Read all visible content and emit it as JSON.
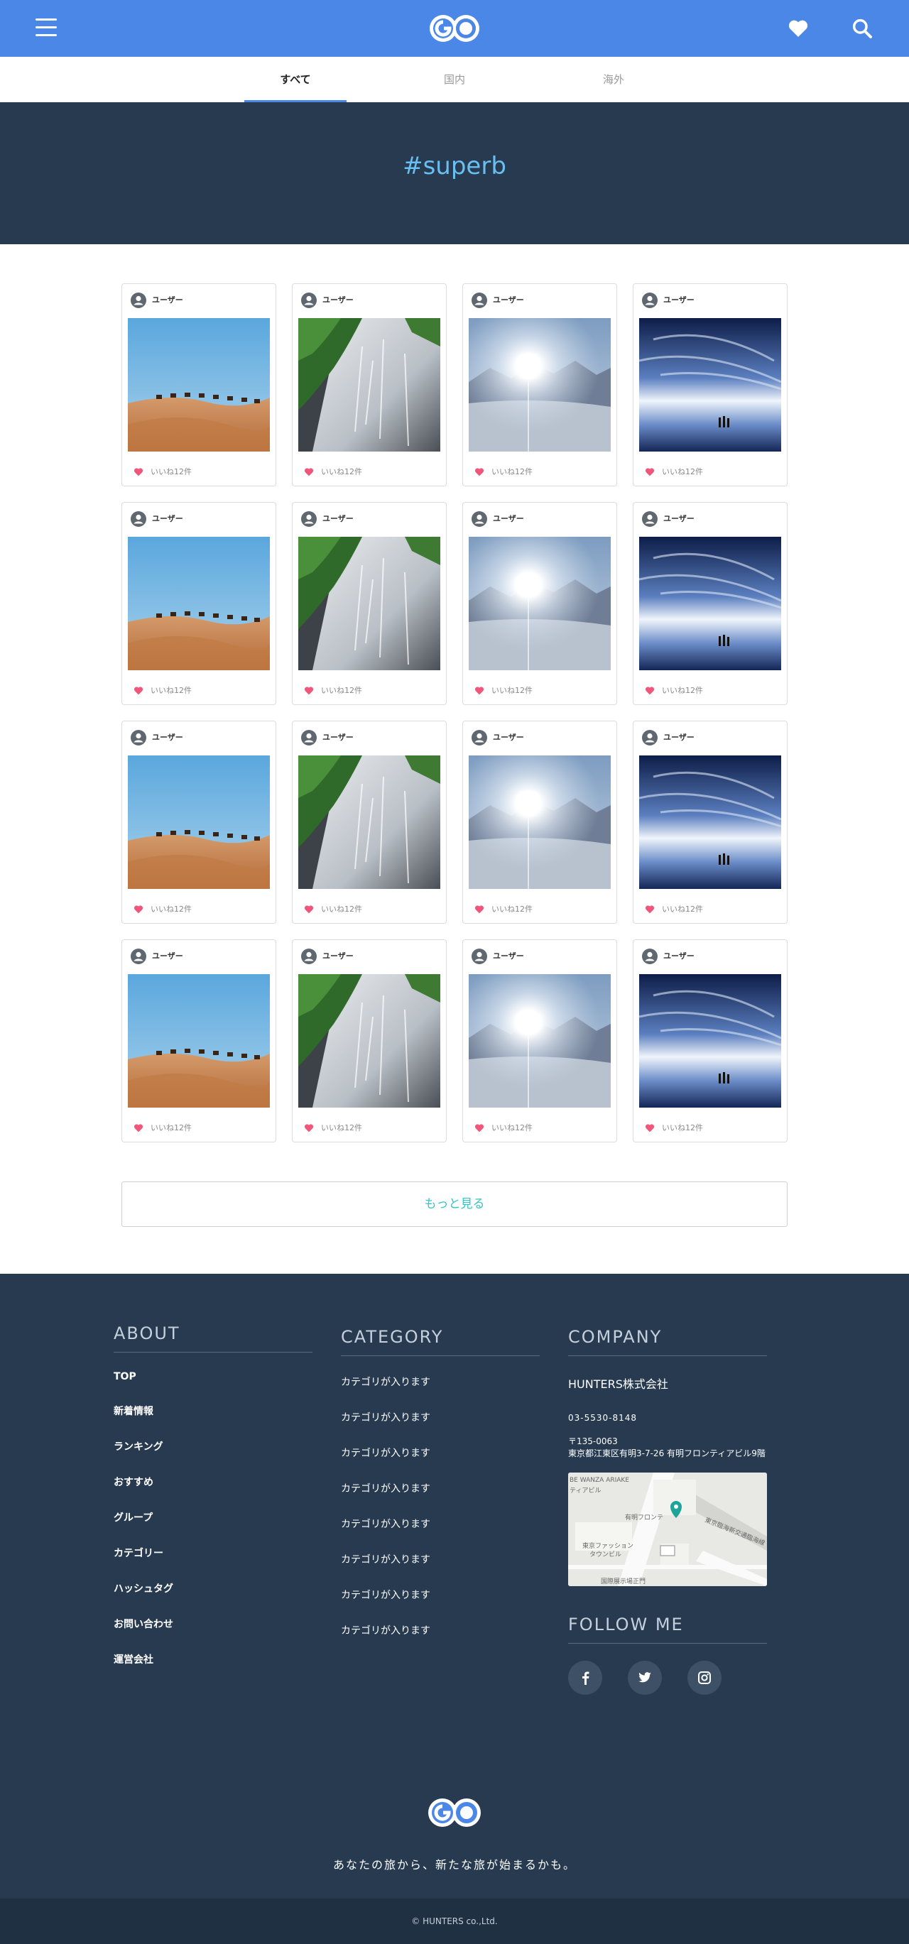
{
  "header": {
    "logo_text": "GO",
    "menu_icon": "hamburger-icon",
    "favorite_icon": "heart-icon",
    "search_icon": "search-icon",
    "brand_color": "#4a87e7"
  },
  "tabs": [
    {
      "label": "すべて",
      "active": true
    },
    {
      "label": "国内",
      "active": false
    },
    {
      "label": "海外",
      "active": false
    }
  ],
  "hero": {
    "title": "#superb"
  },
  "grid": {
    "rows": [
      [
        {
          "user": "ユーザー",
          "likes": "いいね12件",
          "photo": "desert"
        },
        {
          "user": "ユーザー",
          "likes": "いいね12件",
          "photo": "waterfall"
        },
        {
          "user": "ユーザー",
          "likes": "いいね12件",
          "photo": "sunburst"
        },
        {
          "user": "ユーザー",
          "likes": "いいね12件",
          "photo": "salt-flat"
        }
      ],
      [
        {
          "user": "ユーザー",
          "likes": "いいね12件",
          "photo": "desert"
        },
        {
          "user": "ユーザー",
          "likes": "いいね12件",
          "photo": "waterfall"
        },
        {
          "user": "ユーザー",
          "likes": "いいね12件",
          "photo": "sunburst"
        },
        {
          "user": "ユーザー",
          "likes": "いいね12件",
          "photo": "salt-flat"
        }
      ],
      [
        {
          "user": "ユーザー",
          "likes": "いいね12件",
          "photo": "desert"
        },
        {
          "user": "ユーザー",
          "likes": "いいね12件",
          "photo": "waterfall"
        },
        {
          "user": "ユーザー",
          "likes": "いいね12件",
          "photo": "sunburst"
        },
        {
          "user": "ユーザー",
          "likes": "いいね12件",
          "photo": "salt-flat"
        }
      ],
      [
        {
          "user": "ユーザー",
          "likes": "いいね12件",
          "photo": "desert"
        },
        {
          "user": "ユーザー",
          "likes": "いいね12件",
          "photo": "waterfall"
        },
        {
          "user": "ユーザー",
          "likes": "いいね12件",
          "photo": "sunburst"
        },
        {
          "user": "ユーザー",
          "likes": "いいね12件",
          "photo": "salt-flat"
        }
      ]
    ]
  },
  "more_button": {
    "label": "もっと見る"
  },
  "footer": {
    "about": {
      "heading": "ABOUT",
      "links": [
        "TOP",
        "新着情報",
        "ランキング",
        "おすすめ",
        "グループ",
        "カテゴリー",
        "ハッシュタグ",
        "お問い合わせ",
        "運営会社"
      ]
    },
    "category": {
      "heading": "CATEGORY",
      "links": [
        "カテゴリが入ります",
        "カテゴリが入ります",
        "カテゴリが入ります",
        "カテゴリが入ります",
        "カテゴリが入ります",
        "カテゴリが入ります",
        "カテゴリが入ります",
        "カテゴリが入ります"
      ]
    },
    "company": {
      "heading": "COMPANY",
      "name": "HUNTERS株式会社",
      "tel": "03-5530-8148",
      "address": "〒135-0063\n東京都江東区有明3-7-26 有明フロンティアビル9階",
      "map_labels": [
        "BE WANZA ARIAKE",
        "ティアビル",
        "東京ファッション",
        "タウンビル",
        "有明フロンテ",
        "国際展示場正門",
        "東京臨海新交通臨海線"
      ]
    },
    "follow": {
      "heading": "FOLLOW ME",
      "icons": [
        "facebook-icon",
        "twitter-icon",
        "instagram-icon"
      ]
    },
    "logo_text": "GO",
    "tagline": "あなたの旅から、新たな旅が始まるかも。",
    "copyright": "© HUNTERS co.,Ltd."
  },
  "colors": {
    "hero_bg": "#273a50",
    "hashtag": "#69bff2",
    "like_heart": "#f0567a",
    "more_text": "#36c5c5",
    "map_pin": "#1ea59a"
  }
}
